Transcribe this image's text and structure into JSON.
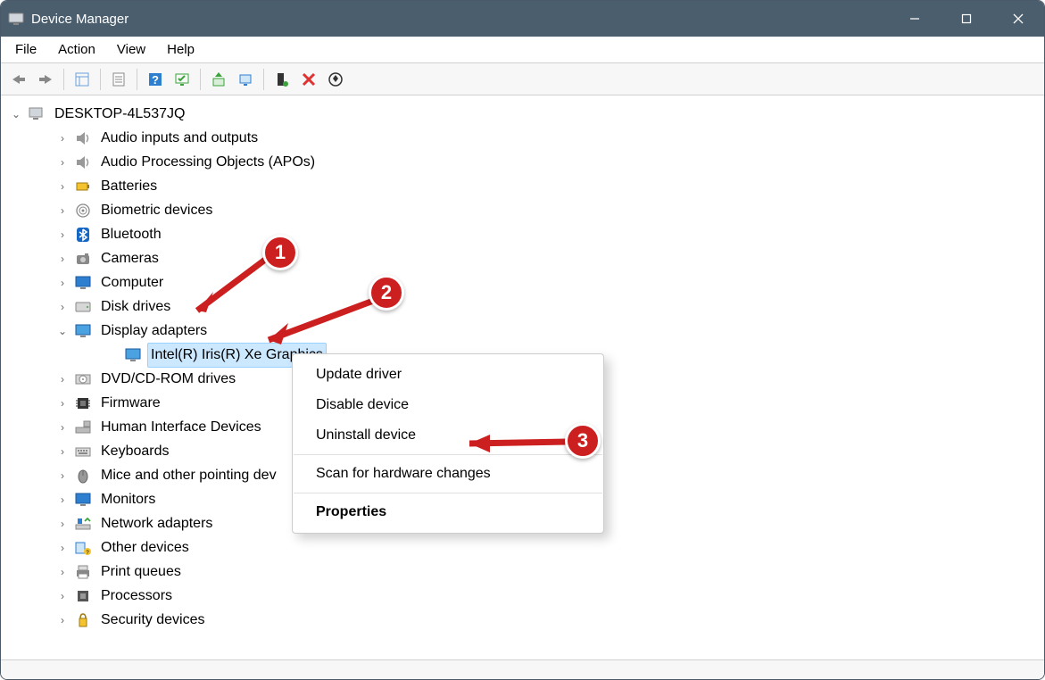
{
  "window": {
    "title": "Device Manager"
  },
  "menu": {
    "file": "File",
    "action": "Action",
    "view": "View",
    "help": "Help"
  },
  "tree": {
    "root": "DESKTOP-4L537JQ",
    "items": [
      {
        "label": "Audio inputs and outputs",
        "icon": "speaker"
      },
      {
        "label": "Audio Processing Objects (APOs)",
        "icon": "speaker"
      },
      {
        "label": "Batteries",
        "icon": "battery"
      },
      {
        "label": "Biometric devices",
        "icon": "fingerprint"
      },
      {
        "label": "Bluetooth",
        "icon": "bluetooth"
      },
      {
        "label": "Cameras",
        "icon": "camera"
      },
      {
        "label": "Computer",
        "icon": "monitor"
      },
      {
        "label": "Disk drives",
        "icon": "disk"
      },
      {
        "label": "Display adapters",
        "icon": "display",
        "expanded": true,
        "children": [
          {
            "label": "Intel(R) Iris(R) Xe Graphics",
            "icon": "display",
            "selected": true
          }
        ]
      },
      {
        "label": "DVD/CD-ROM drives",
        "icon": "cd"
      },
      {
        "label": "Firmware",
        "icon": "chip"
      },
      {
        "label": "Human Interface Devices",
        "icon": "hid"
      },
      {
        "label": "Keyboards",
        "icon": "keyboard"
      },
      {
        "label": "Mice and other pointing dev",
        "icon": "mouse"
      },
      {
        "label": "Monitors",
        "icon": "monitor"
      },
      {
        "label": "Network adapters",
        "icon": "network"
      },
      {
        "label": "Other devices",
        "icon": "other"
      },
      {
        "label": "Print queues",
        "icon": "printer"
      },
      {
        "label": "Processors",
        "icon": "cpu"
      },
      {
        "label": "Security devices",
        "icon": "security"
      }
    ]
  },
  "context_menu": {
    "update": "Update driver",
    "disable": "Disable device",
    "uninstall": "Uninstall device",
    "scan": "Scan for hardware changes",
    "properties": "Properties"
  },
  "annotations": {
    "one": "1",
    "two": "2",
    "three": "3"
  }
}
